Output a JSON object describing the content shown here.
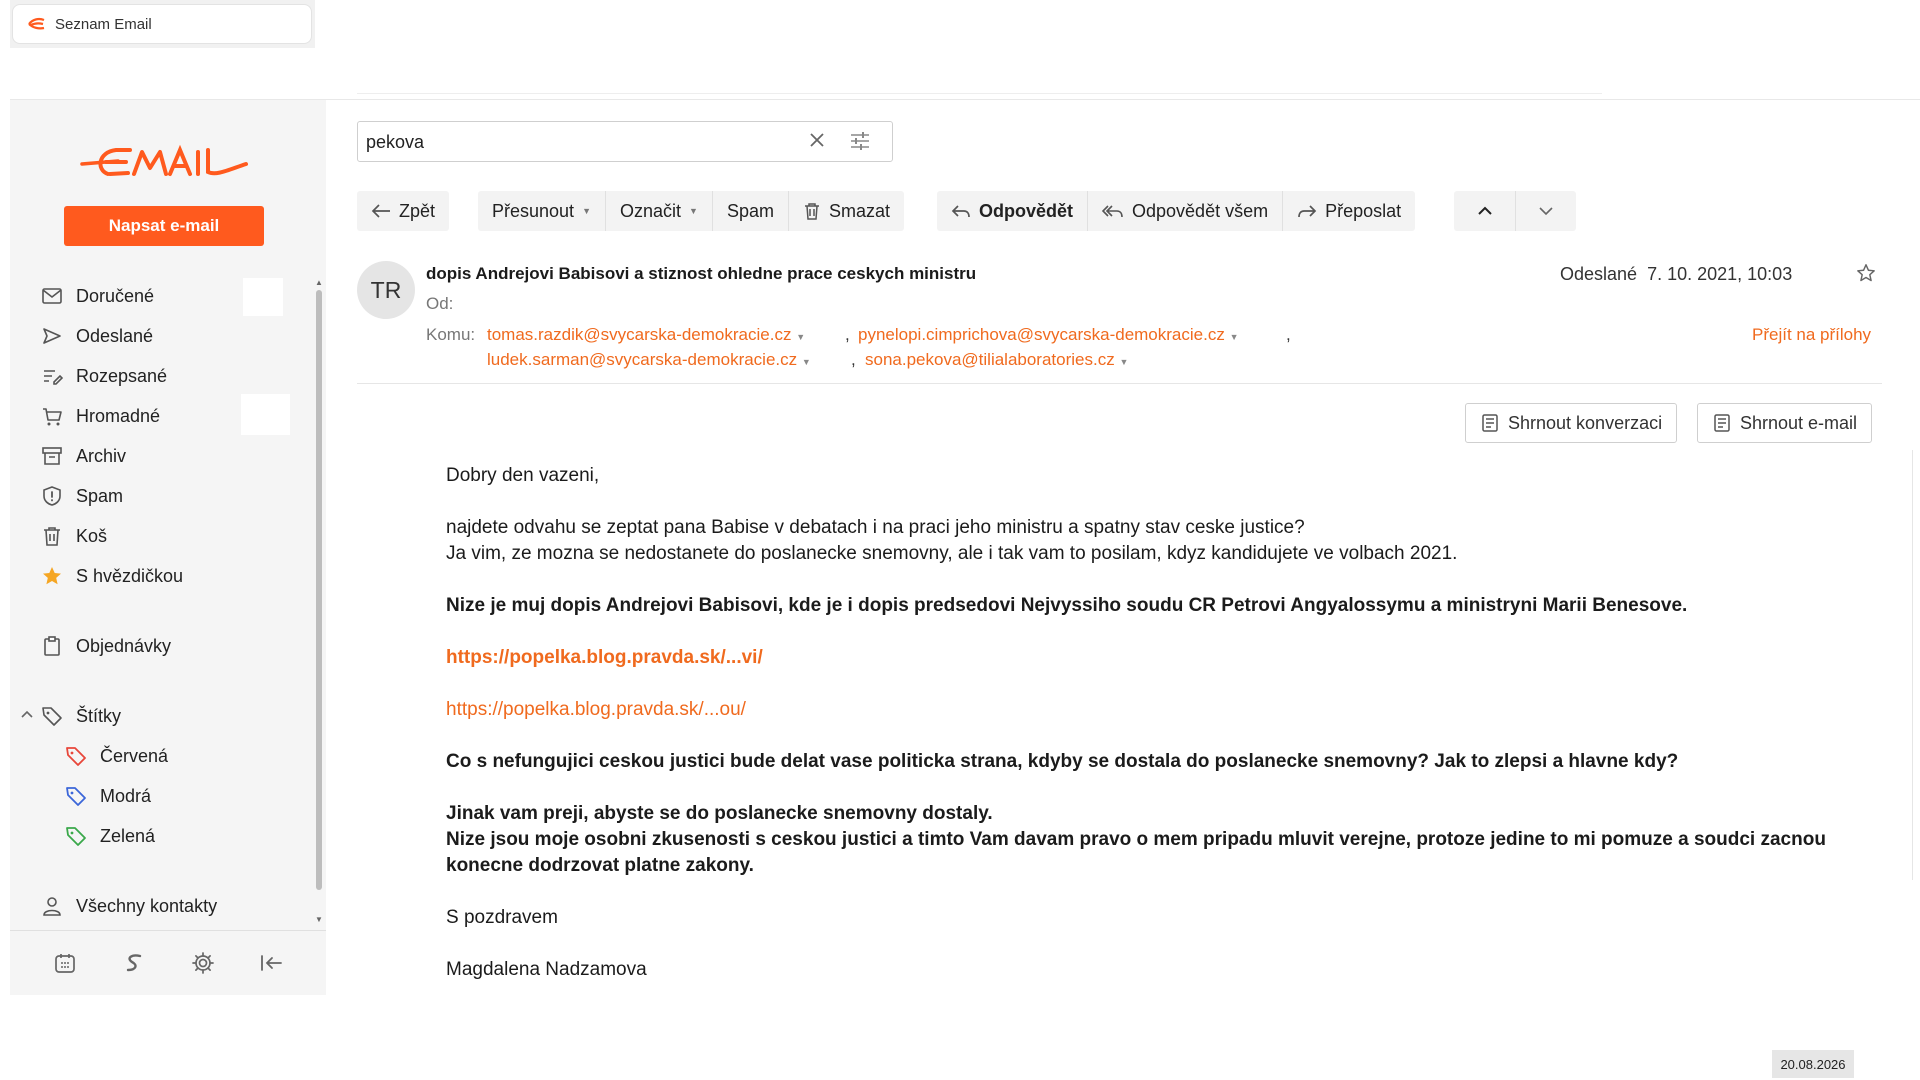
{
  "browser": {
    "tab_title": "Seznam Email"
  },
  "brand": {
    "logo_text": "EMAIL",
    "accent": "#ff5a1e",
    "link_color": "#f06a1e"
  },
  "compose_label": "Napsat e-mail",
  "folders": [
    {
      "label": "Doručené",
      "icon": "inbox-icon"
    },
    {
      "label": "Odeslané",
      "icon": "send-icon"
    },
    {
      "label": "Rozepsané",
      "icon": "draft-icon"
    },
    {
      "label": "Hromadné",
      "icon": "cart-icon"
    },
    {
      "label": "Archiv",
      "icon": "archive-icon"
    },
    {
      "label": "Spam",
      "icon": "shield-icon"
    },
    {
      "label": "Koš",
      "icon": "trash-icon"
    },
    {
      "label": "S hvězdičkou",
      "icon": "star-icon"
    }
  ],
  "orders_label": "Objednávky",
  "labels_section": "Štítky",
  "tags": [
    {
      "label": "Červená",
      "color": "#e8463a"
    },
    {
      "label": "Modrá",
      "color": "#3b66d9"
    },
    {
      "label": "Zelená",
      "color": "#3aa84a"
    }
  ],
  "contacts_label": "Všechny kontakty",
  "search": {
    "value": "pekova"
  },
  "toolbar": {
    "back": "Zpět",
    "move": "Přesunout",
    "mark": "Označit",
    "spam": "Spam",
    "delete": "Smazat",
    "reply": "Odpovědět",
    "reply_all": "Odpovědět všem",
    "forward": "Přeposlat"
  },
  "message": {
    "avatar_initials": "TR",
    "subject": "dopis Andrejovi Babisovi a stiznost ohledne prace ceskych ministru",
    "sent_label": "Odeslané",
    "sent_date": "7. 10. 2021, 10:03",
    "from_label": "Od:",
    "to_label": "Komu:",
    "recipients": [
      "tomas.razdik@svycarska-demokracie.cz",
      "pynelopi.cimprichova@svycarska-demokracie.cz",
      "ludek.sarman@svycarska-demokracie.cz",
      "sona.pekova@tilialaboratories.cz"
    ],
    "separator": ",",
    "attachments_link": "Přejít na přílohy",
    "summarize_conversation": "Shrnout konverzaci",
    "summarize_email": "Shrnout e-mail",
    "body": {
      "greeting": "Dobry den vazeni,",
      "para1_line1": "najdete odvahu se zeptat pana Babise v debatach  i na praci jeho ministru a spatny stav ceske justice?",
      "para1_line2": "Ja vim, ze mozna se nedostanete do poslanecke snemovny, ale i tak vam to posilam, kdyz kandidujete ve volbach 2021.",
      "para2": "Nize je muj dopis Andrejovi Babisovi, kde je i dopis predsedovi Nejvyssiho soudu CR Petrovi Angyalossymu a ministryni Marii Benesove.",
      "link1": "https://popelka.blog.pravda.sk/...vi/",
      "link2": "https://popelka.blog.pravda.sk/...ou/",
      "para3": "Co s nefungujici ceskou justici bude delat  vase politicka strana, kdyby se dostala do poslanecke snemovny? Jak to zlepsi a hlavne kdy?",
      "para4_line1": "Jinak vam preji, abyste se do poslanecke snemovny dostaly.",
      "para4_line2": "Nize jsou moje osobni zkusenosti s ceskou justici a timto Vam davam pravo o mem pripadu mluvit verejne, protoze jedine to mi pomuze a soudci zacnou konecne dodrzovat platne zakony.",
      "closing": "S pozdravem",
      "signature": "Magdalena Nadzamova"
    }
  },
  "footer_date": "20.08.2026"
}
